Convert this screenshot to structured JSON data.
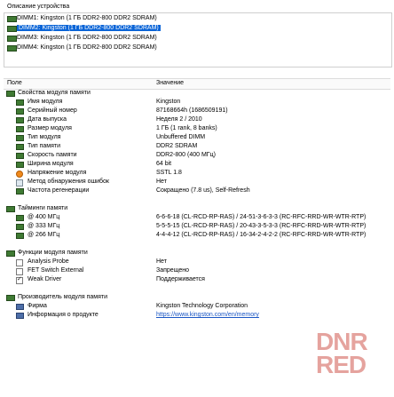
{
  "device_panel": {
    "title": "Описание устройства",
    "devices": [
      {
        "label": "DIMM1: Kingston (1 ГБ DDR2-800 DDR2 SDRAM)",
        "selected": false
      },
      {
        "label": "DIMM2: Kingston (1 ГБ DDR2-800 DDR2 SDRAM)",
        "selected": true
      },
      {
        "label": "DIMM3: Kingston (1 ГБ DDR2-800 DDR2 SDRAM)",
        "selected": false
      },
      {
        "label": "DIMM4: Kingston (1 ГБ DDR2-800 DDR2 SDRAM)",
        "selected": false
      }
    ]
  },
  "columns": {
    "field": "Поле",
    "value": "Значение"
  },
  "sections": [
    {
      "title": "Свойства модуля памяти",
      "items": [
        {
          "label": "Имя модуля",
          "value": "Kingston",
          "icon": "memory-module-icon"
        },
        {
          "label": "Серийный номер",
          "value": "87168664h (1686509191)",
          "icon": "memory-module-icon"
        },
        {
          "label": "Дата выпуска",
          "value": "Неделя 2 / 2010",
          "icon": "memory-module-icon"
        },
        {
          "label": "Размер модуля",
          "value": "1 ГБ (1 rank, 8 banks)",
          "icon": "memory-module-icon"
        },
        {
          "label": "Тип модуля",
          "value": "Unbuffered DIMM",
          "icon": "memory-module-icon"
        },
        {
          "label": "Тип памяти",
          "value": "DDR2 SDRAM",
          "icon": "memory-module-icon"
        },
        {
          "label": "Скорость памяти",
          "value": "DDR2-800 (400 МГц)",
          "icon": "memory-module-icon"
        },
        {
          "label": "Ширина модуля",
          "value": "64 bit",
          "icon": "memory-module-icon"
        },
        {
          "label": "Напряжение модуля",
          "value": "SSTL 1.8",
          "icon": "voltage-icon"
        },
        {
          "label": "Метод обнаружения ошибок",
          "value": "Нет",
          "icon": "document-icon"
        },
        {
          "label": "Частота регенерации",
          "value": "Сокращено (7.8 us), Self-Refresh",
          "icon": "memory-module-icon"
        }
      ]
    },
    {
      "title": "Тайминги памяти",
      "items": [
        {
          "label": "@ 400 МГц",
          "value": "6-6-6-18  (CL-RCD-RP-RAS) / 24-51-3-6-3-3  (RC-RFC-RRD-WR-WTR-RTP)",
          "icon": "memory-module-icon"
        },
        {
          "label": "@ 333 МГц",
          "value": "5-5-5-15  (CL-RCD-RP-RAS) / 20-43-3-5-3-3  (RC-RFC-RRD-WR-WTR-RTP)",
          "icon": "memory-module-icon"
        },
        {
          "label": "@ 266 МГц",
          "value": "4-4-4-12  (CL-RCD-RP-RAS) / 16-34-2-4-2-2  (RC-RFC-RRD-WR-WTR-RTP)",
          "icon": "memory-module-icon"
        }
      ]
    },
    {
      "title": "Функции модуля памяти",
      "items": [
        {
          "label": "Analysis Probe",
          "value": "Нет",
          "icon": "checkbox-icon",
          "checked": false
        },
        {
          "label": "FET Switch External",
          "value": "Запрещено",
          "icon": "checkbox-icon",
          "checked": false
        },
        {
          "label": "Weak Driver",
          "value": "Поддерживается",
          "icon": "checkbox-icon",
          "checked": true
        }
      ]
    },
    {
      "title": "Производитель модуля памяти",
      "items": [
        {
          "label": "Фирма",
          "value": "Kingston Technology Corporation",
          "icon": "factory-icon"
        },
        {
          "label": "Информация о продукте",
          "value": "https://www.kingston.com/en/memory",
          "icon": "factory-icon",
          "link": true
        }
      ]
    }
  ],
  "watermark": {
    "line1": "DNR",
    "line2": "RED",
    "color": "#c6342a"
  },
  "colors": {
    "selection": "#0a64d7",
    "link": "#1a56c4",
    "module_icon": "#3f7a33"
  }
}
